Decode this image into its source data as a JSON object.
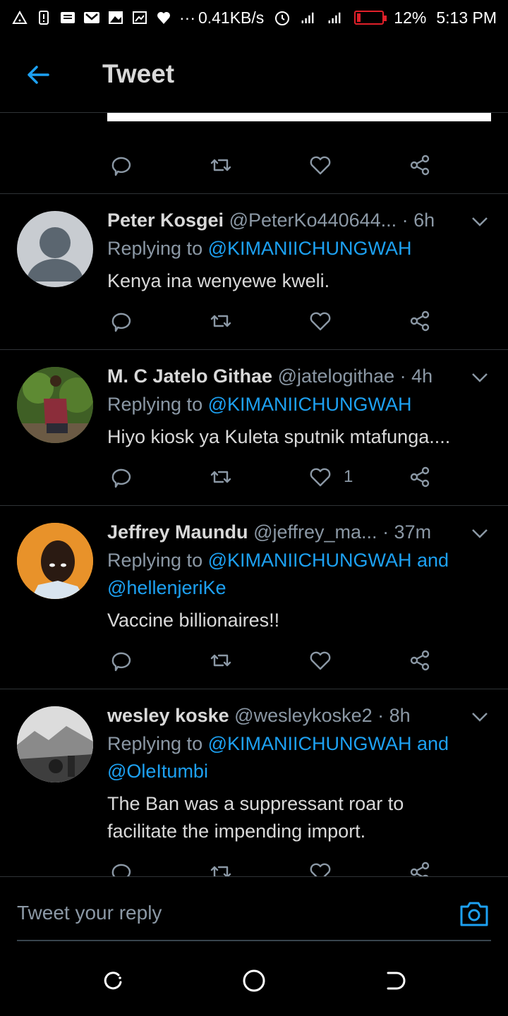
{
  "status_bar": {
    "net_speed": "0.41KB/s",
    "battery": "12%",
    "time": "5:13 PM",
    "dots": "···"
  },
  "header": {
    "title": "Tweet"
  },
  "replies": [
    {
      "name": "Peter Kosgei",
      "handle": "@PeterKo440644...",
      "time": "· 6h",
      "replying_prefix": "Replying to ",
      "replying_to": "@KIMANIICHUNGWAH",
      "text": "Kenya ina wenyewe kweli.",
      "likes": ""
    },
    {
      "name": "M. C Jatelo Githae",
      "handle": "@jatelogithae",
      "time": "· 4h",
      "replying_prefix": "Replying to ",
      "replying_to": "@KIMANIICHUNGWAH",
      "text": "Hiyo kiosk ya Kuleta sputnik mtafunga....",
      "likes": "1"
    },
    {
      "name": "Jeffrey Maundu",
      "handle": "@jeffrey_ma...",
      "time": "· 37m",
      "replying_prefix": "Replying to ",
      "replying_to": "@KIMANIICHUNGWAH and",
      "replying_to_2": "@hellenjeriKe",
      "text": "Vaccine billionaires!!",
      "likes": ""
    },
    {
      "name": "wesley koske",
      "handle": "@wesleykoske2",
      "time": "· 8h",
      "replying_prefix": "Replying to ",
      "replying_to": "@KIMANIICHUNGWAH and",
      "replying_to_2": "@OleItumbi",
      "text_line1": "The Ban was a suppressant roar to",
      "text_line2": "facilitate the impending  import.",
      "likes": ""
    }
  ],
  "compose": {
    "placeholder": "Tweet your reply"
  },
  "colors": {
    "accent": "#1da1f2",
    "background": "#000000",
    "muted": "#8b98a5",
    "text": "#d9d9d9",
    "battery": "#e0202a"
  }
}
